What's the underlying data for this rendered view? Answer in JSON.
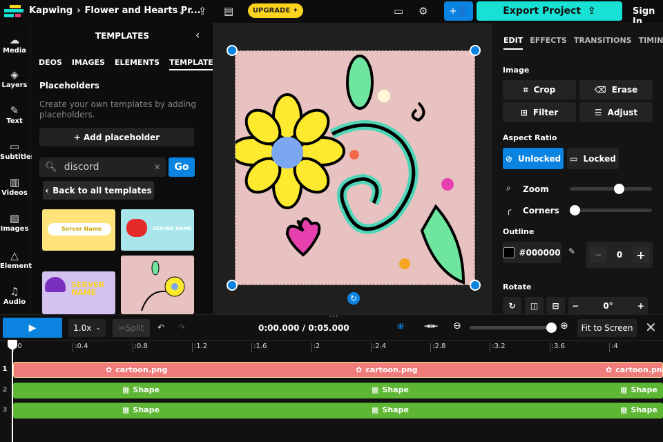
{
  "header": {
    "brand": "Kapwing",
    "breadcrumb_sep": "›",
    "project_title": "Flower and Hearts Pr...",
    "upgrade": "UPGRADE",
    "export": "Export Project",
    "sign_in": "Sign In"
  },
  "rail": [
    {
      "label": "Media",
      "icon": "upload-cloud-icon"
    },
    {
      "label": "Layers",
      "icon": "layers-icon"
    },
    {
      "label": "Text",
      "icon": "text-icon"
    },
    {
      "label": "Subtitles",
      "icon": "subtitles-icon"
    },
    {
      "label": "Videos",
      "icon": "film-icon"
    },
    {
      "label": "Images",
      "icon": "image-icon"
    },
    {
      "label": "Elements",
      "icon": "shapes-icon"
    },
    {
      "label": "Audio",
      "icon": "music-icon"
    }
  ],
  "panel": {
    "title": "TEMPLATES",
    "tabs": [
      "DEOS",
      "IMAGES",
      "ELEMENTS",
      "TEMPLATES"
    ],
    "active_tab": "TEMPLATES",
    "section": "Placeholders",
    "description": "Create your own templates by adding placeholders.",
    "add_placeholder": "+ Add placeholder",
    "search_value": "discord",
    "go": "Go",
    "back": "Back to all templates",
    "thumbs": [
      {
        "text": "Server Name",
        "bg": "#fde37a"
      },
      {
        "text": "SERVER NAME",
        "bg": "#a8e6ec"
      },
      {
        "text": "SERVER NAME",
        "bg": "#d3c2f0"
      },
      {
        "text": "",
        "bg": "#e8c1c1"
      }
    ]
  },
  "right": {
    "tabs": [
      "EDIT",
      "EFFECTS",
      "TRANSITIONS",
      "TIMING"
    ],
    "active_tab": "EDIT",
    "image_label": "Image",
    "crop": "Crop",
    "erase": "Erase",
    "filter": "Filter",
    "adjust": "Adjust",
    "aspect_label": "Aspect Ratio",
    "unlocked": "Unlocked",
    "locked": "Locked",
    "aspect_selected": "Unlocked",
    "zoom": "Zoom",
    "zoom_value": 0.6,
    "corners": "Corners",
    "corners_value": 0,
    "outline_label": "Outline",
    "outline_color": "#000000",
    "outline_width": "0",
    "rotate_label": "Rotate",
    "rotate_value": "0°"
  },
  "timeline": {
    "speed": "1.0x",
    "split": "Split",
    "time": "0:00.000 / 0:05.000",
    "fit": "Fit to Screen",
    "zoom_value": 0.95,
    "ticks": [
      ":0",
      ":0.4",
      ":0.8",
      ":1.2",
      ":1.6",
      ":2",
      ":2.4",
      ":2.8",
      ":3.2",
      ":3.6",
      ":4"
    ],
    "tracks": [
      {
        "num": "1",
        "label": "cartoon.png",
        "color": "#ef7b7b"
      },
      {
        "num": "2",
        "label": "Shape",
        "color": "#5db634"
      },
      {
        "num": "3",
        "label": "Shape",
        "color": "#5db634"
      }
    ]
  },
  "colors": {
    "accent": "#0a84e0",
    "export": "#17e1d5",
    "upgrade": "#fcd31f",
    "canvas": "#e8c1c1"
  }
}
